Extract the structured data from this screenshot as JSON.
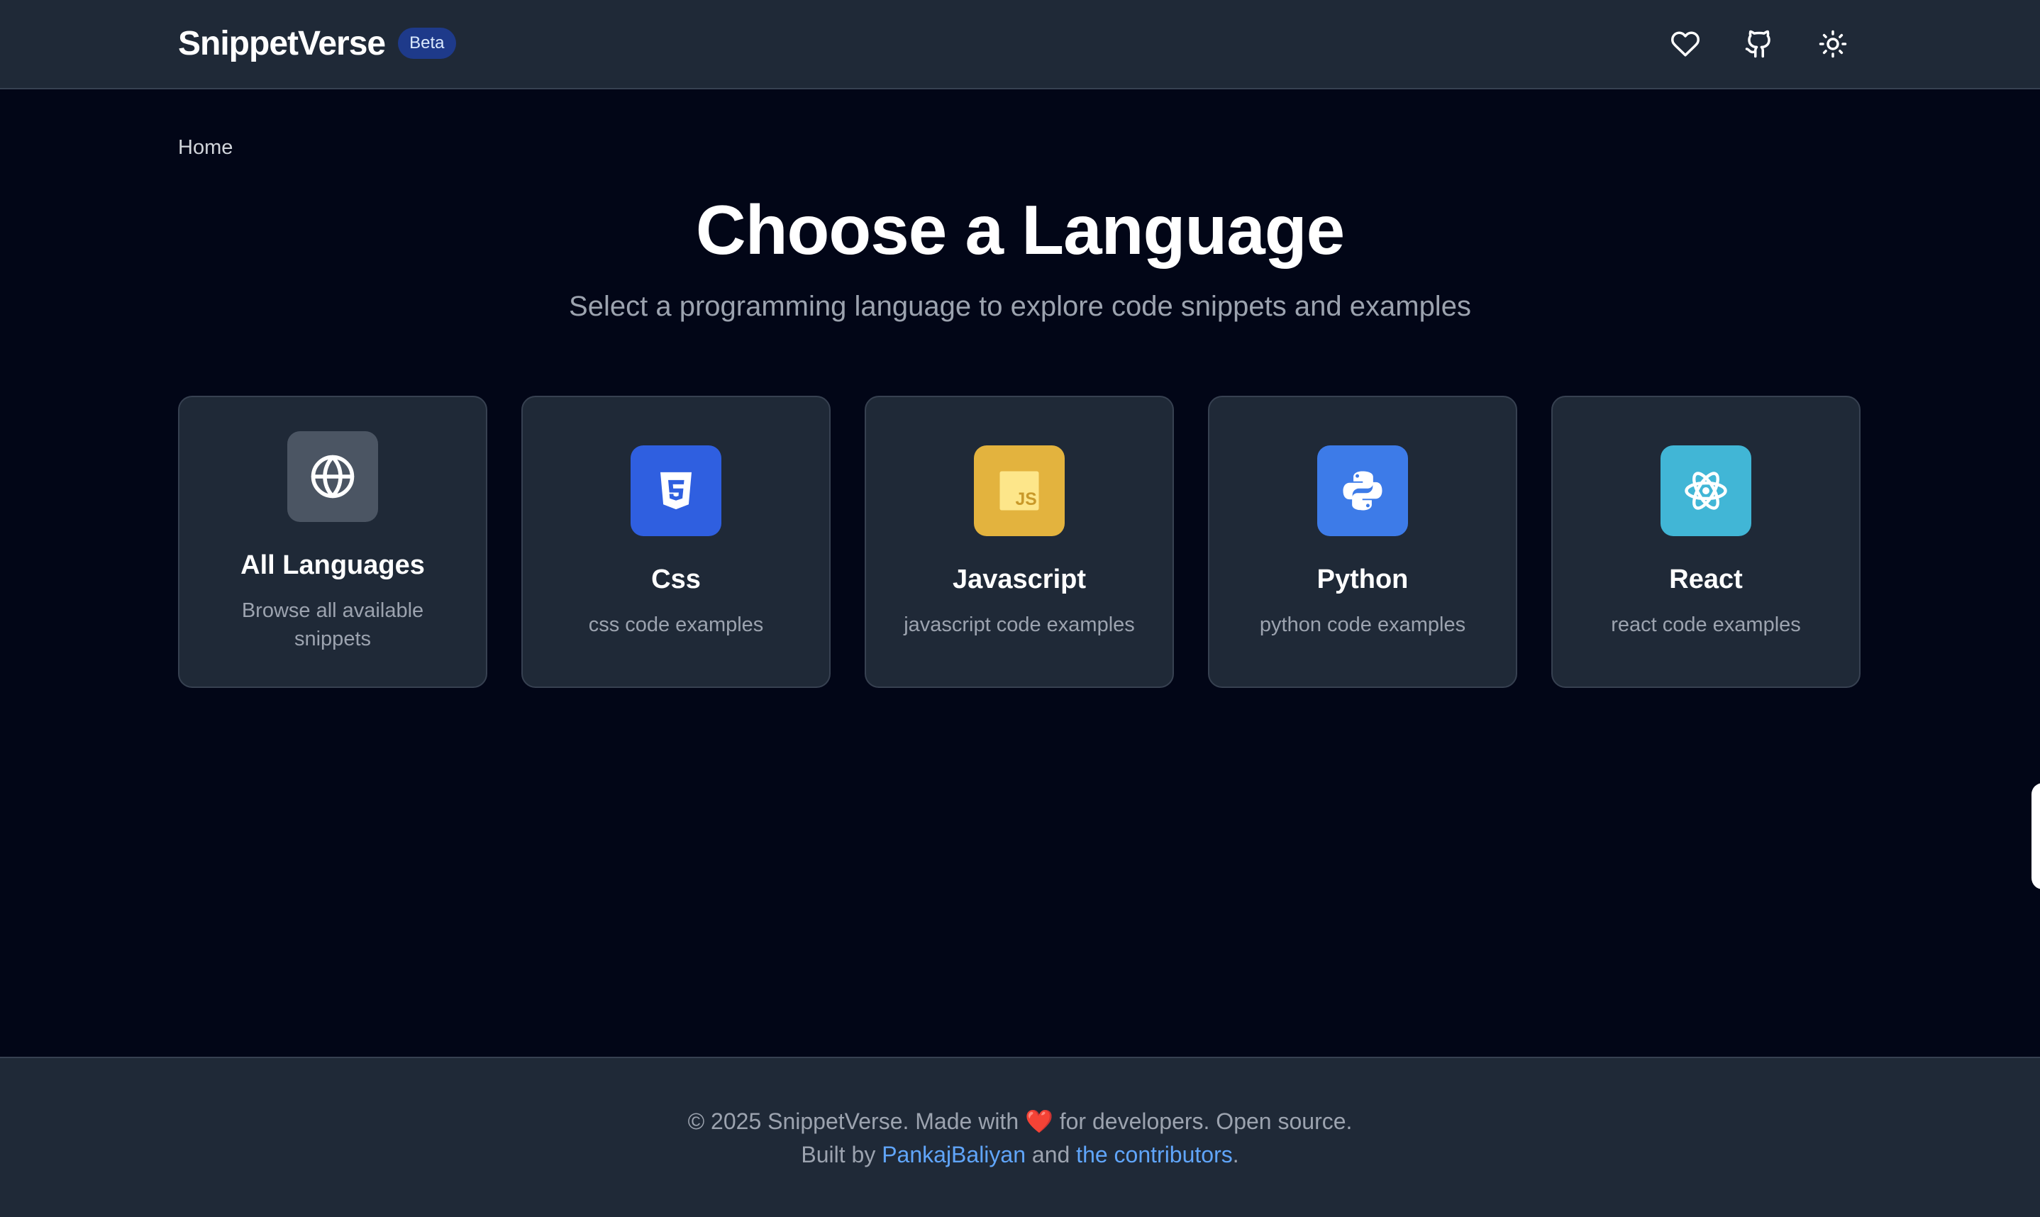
{
  "header": {
    "brand": "SnippetVerse",
    "badge": "Beta",
    "actions": [
      {
        "icon": "heart-icon"
      },
      {
        "icon": "github-icon"
      },
      {
        "icon": "sun-icon"
      }
    ]
  },
  "breadcrumb": {
    "home": "Home"
  },
  "hero": {
    "title": "Choose a Language",
    "subtitle": "Select a programming language to explore code snippets and examples"
  },
  "cards": [
    {
      "title": "All Languages",
      "desc": "Browse all available snippets",
      "icon": "globe-icon",
      "color": "#4b5563"
    },
    {
      "title": "Css",
      "desc": "css code examples",
      "icon": "css3-icon",
      "color": "#2f5fe0"
    },
    {
      "title": "Javascript",
      "desc": "javascript code examples",
      "icon": "js-icon",
      "color": "#e3b33e"
    },
    {
      "title": "Python",
      "desc": "python code examples",
      "icon": "python-icon",
      "color": "#3d7be8"
    },
    {
      "title": "React",
      "desc": "react code examples",
      "icon": "react-icon",
      "color": "#41b6d6"
    }
  ],
  "footer": {
    "copyright": "© 2025 SnippetVerse. Made with",
    "heart": "❤️",
    "tail": "for developers. Open source.",
    "built_by": "Built by",
    "author_link": "PankajBaliyan",
    "and": "and",
    "contributors_link": "the contributors",
    "period": "."
  }
}
